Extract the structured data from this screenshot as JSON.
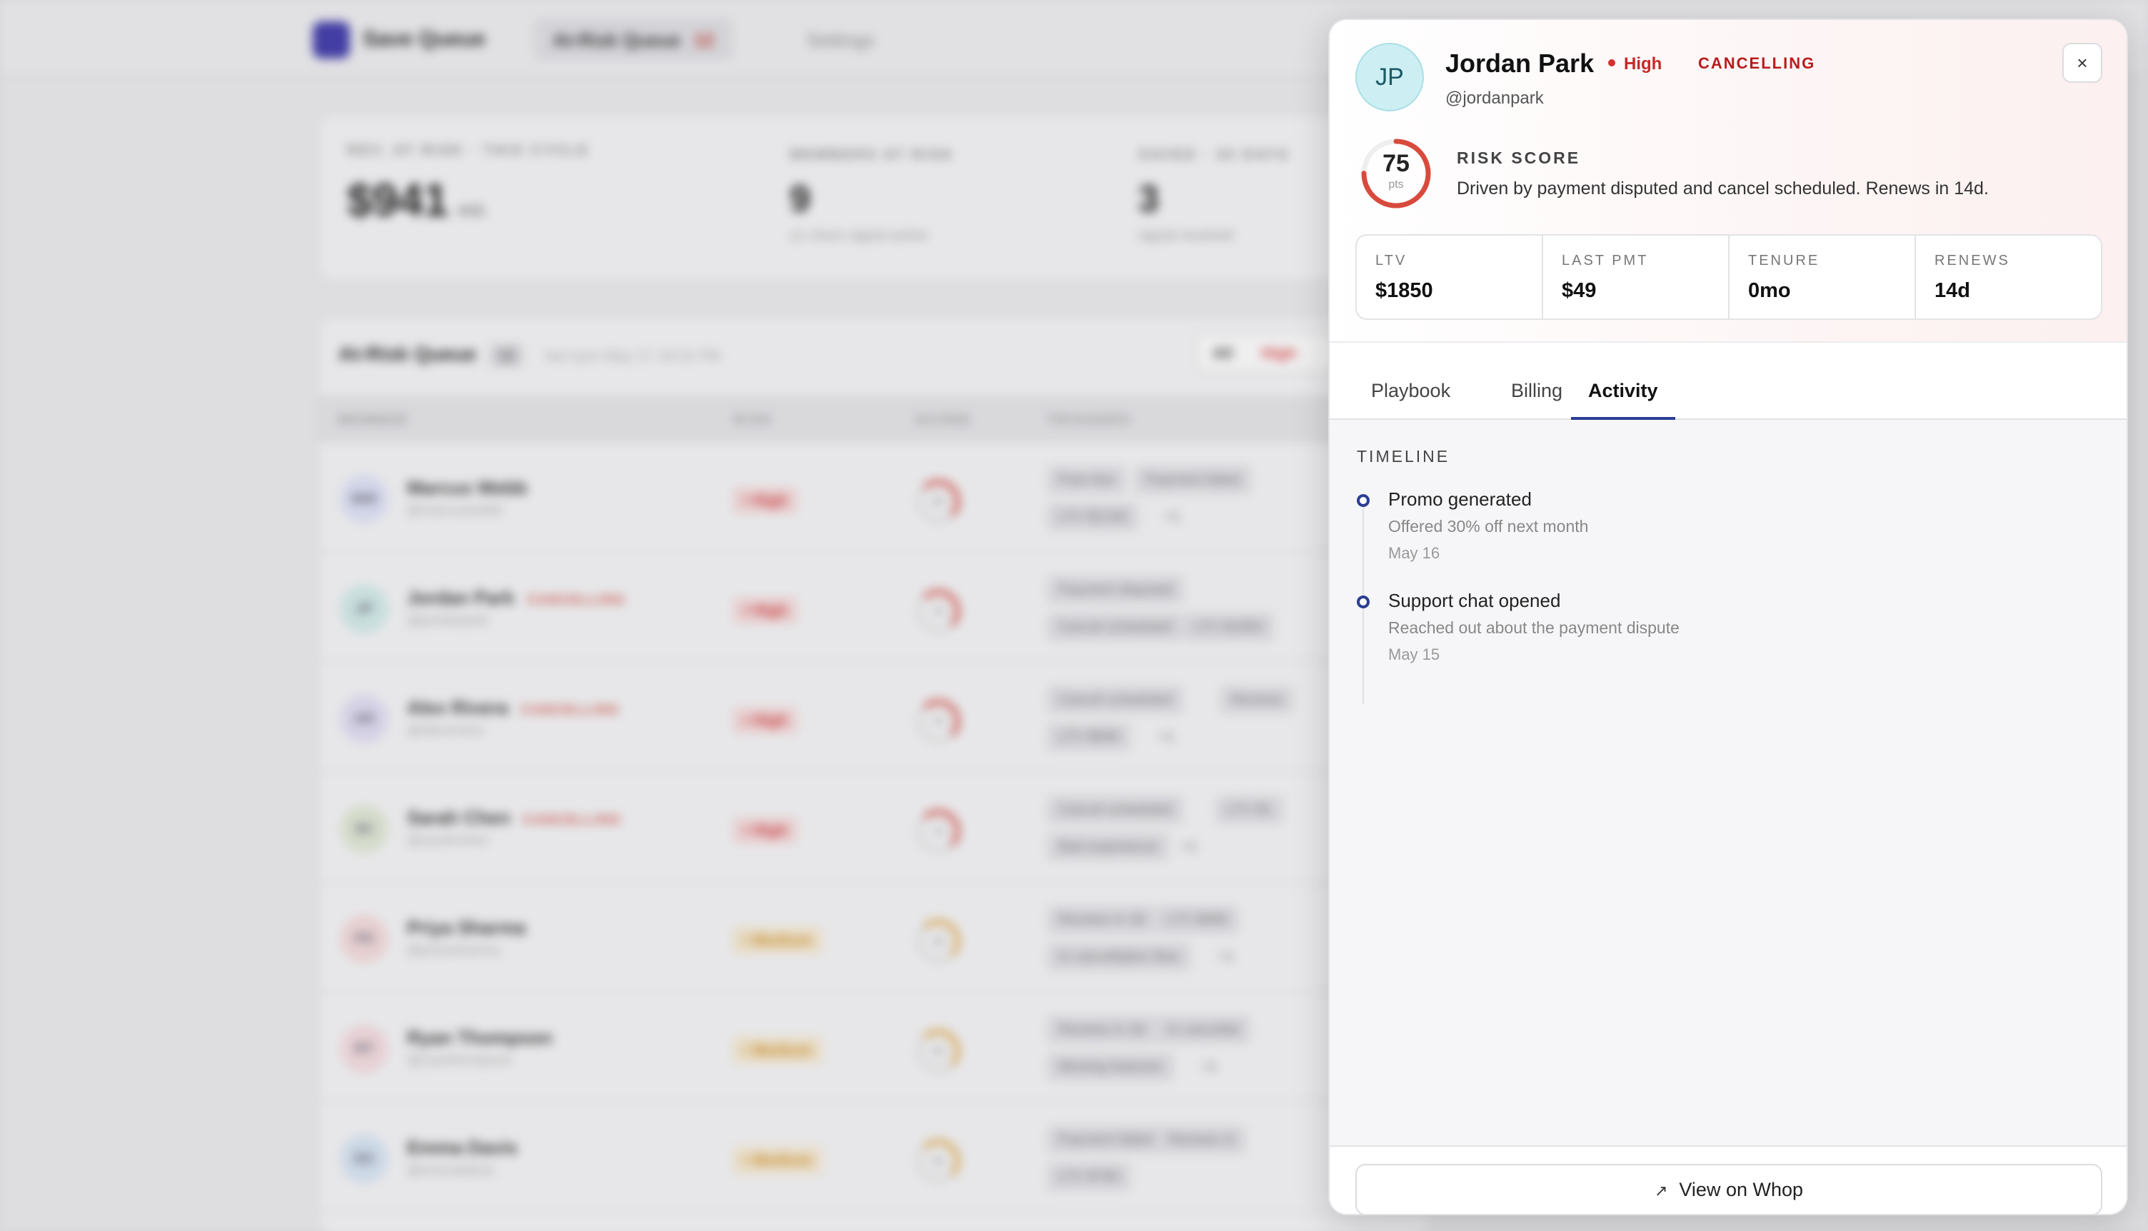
{
  "app": {
    "brand": "Save Queue",
    "nav": {
      "at_risk_label": "At-Risk Queue",
      "at_risk_count": "12",
      "settings_label": "Settings"
    }
  },
  "stats": {
    "revenue": {
      "label": "REV. AT RISK · THIS CYCLE",
      "value": "$941",
      "suffix": "est."
    },
    "members": {
      "label": "MEMBERS AT RISK",
      "value": "9",
      "sub": "≥1 churn signal active"
    },
    "saved": {
      "label": "SAVED · 30 DAYS",
      "value": "3",
      "sub": "signal resolved"
    }
  },
  "queue": {
    "title": "At-Risk Queue",
    "count": "12",
    "sync": "last sync May 17, 04:31 PM",
    "filters": {
      "all": "All",
      "high": "High"
    },
    "columns": {
      "member": "MEMBER",
      "risk": "RISK",
      "score": "SCORE",
      "triggers": "TRIGGERS"
    },
    "rows": [
      {
        "initials": "MW",
        "name": "Marcus Webb",
        "handle": "@marcuswebb",
        "cancelling": "",
        "risk": "High",
        "score": "85",
        "chips": [
          "Past due",
          "Payment failed",
          "LTV $2100",
          "+1"
        ]
      },
      {
        "initials": "JP",
        "name": "Jordan Park",
        "handle": "@jordanpark",
        "cancelling": "CANCELLING",
        "risk": "High",
        "score": "75",
        "chips": [
          "Payment disputed",
          "Cancel scheduled",
          "LTV $1850"
        ]
      },
      {
        "initials": "AR",
        "name": "Alex Rivera",
        "handle": "@alexrivera",
        "cancelling": "CANCELLING",
        "risk": "High",
        "score": "70",
        "chips": [
          "Cancel scheduled",
          "Renews",
          "LTV $890",
          "+1"
        ]
      },
      {
        "initials": "SC",
        "name": "Sarah Chen",
        "handle": "@sarahchen",
        "cancelling": "CANCELLING",
        "risk": "High",
        "score": "70",
        "chips": [
          "Cancel scheduled",
          "LTV $1",
          "Bad experience",
          "+1"
        ]
      },
      {
        "initials": "PS",
        "name": "Priya Sharma",
        "handle": "@priyasharma",
        "cancelling": "",
        "risk": "Medium",
        "score": "45",
        "chips": [
          "Renews in 3d",
          "LTV $980",
          "In cancellation flow",
          "+1"
        ]
      },
      {
        "initials": "RT",
        "name": "Ryan Thompson",
        "handle": "@ryanthompson",
        "cancelling": "",
        "risk": "Medium",
        "score": "55",
        "chips": [
          "Renews in 3d",
          "In cancellat",
          "Missing features",
          "+1"
        ]
      },
      {
        "initials": "ED",
        "name": "Emma Davis",
        "handle": "@emmadavis",
        "cancelling": "",
        "risk": "Medium",
        "score": "50",
        "chips": [
          "Payment failed",
          "Renews in",
          "LTV $760"
        ]
      }
    ]
  },
  "panel": {
    "initials": "JP",
    "name": "Jordan Park",
    "risk": "High",
    "status": "CANCELLING",
    "handle": "@jordanpark",
    "close_icon": "×",
    "risk_score": {
      "value": "75",
      "fraction": 0.75,
      "unit": "pts",
      "label": "RISK SCORE",
      "text": "Driven by payment disputed and cancel scheduled. Renews in 14d.",
      "color": "#d84a3c"
    },
    "metrics": [
      {
        "label": "LTV",
        "value": "$1850"
      },
      {
        "label": "LAST PMT",
        "value": "$49"
      },
      {
        "label": "TENURE",
        "value": "0mo"
      },
      {
        "label": "RENEWS",
        "value": "14d"
      }
    ],
    "tabs": [
      "Playbook",
      "Billing",
      "Activity"
    ],
    "active_tab": "Activity",
    "timeline": {
      "title": "TIMELINE",
      "items": [
        {
          "heading": "Promo generated",
          "desc": "Offered 30% off next month",
          "date": "May 16"
        },
        {
          "heading": "Support chat opened",
          "desc": "Reached out about the payment dispute",
          "date": "May 15"
        }
      ]
    },
    "footer": {
      "button_label": "View on Whop",
      "icon": "↗"
    }
  }
}
